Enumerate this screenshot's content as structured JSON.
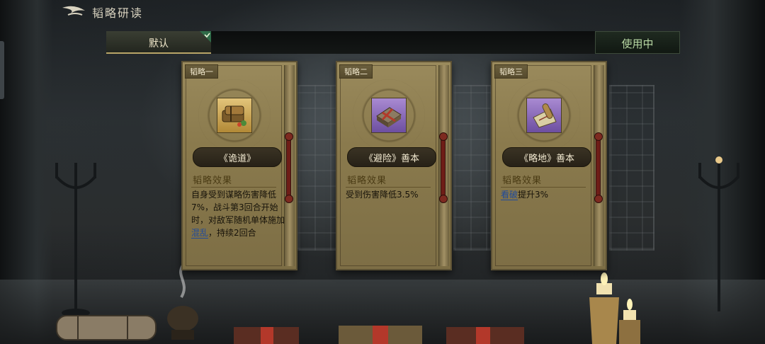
{
  "header": {
    "title": "韬略研读"
  },
  "tabs": {
    "default_label": "默认",
    "in_use_label": "使用中"
  },
  "cards": [
    {
      "tag": "韬略一",
      "name": "《诡道》",
      "effect_title": "韬略效果",
      "effect_parts": [
        "自身受到谋略伤害降低7%，战斗第3回合开始时，对敌军随机单体施加",
        "混乱",
        "，持续2回合"
      ],
      "icon": "bundled-scroll-books-icon"
    },
    {
      "tag": "韬略二",
      "name": "《避险》善本",
      "effect_title": "韬略效果",
      "effect_parts": [
        "受到伤害降低3.5%"
      ],
      "icon": "tied-book-icon"
    },
    {
      "tag": "韬略三",
      "name": "《略地》善本",
      "effect_title": "韬略效果",
      "effect_parts": [
        "看破",
        "提升3%"
      ],
      "icon": "unrolled-map-scroll-icon"
    }
  ],
  "colors": {
    "card_bg": "#8a7a4d",
    "keyword_blue": "#1f4a9c",
    "in_use_green": "#b9d9a4"
  }
}
